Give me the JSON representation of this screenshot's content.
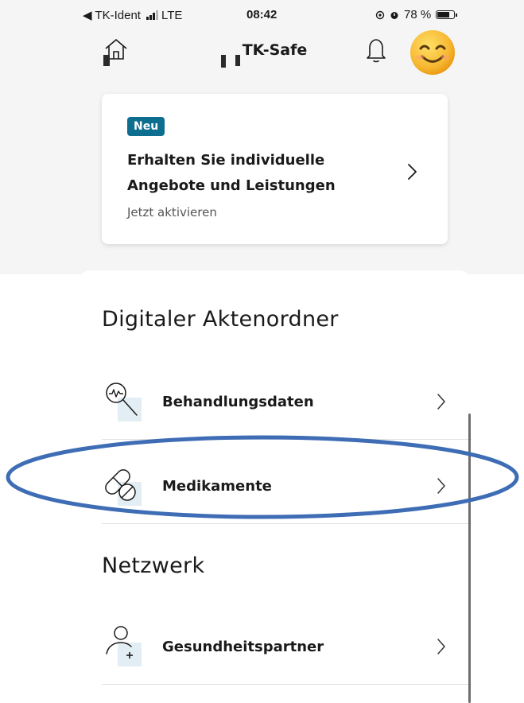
{
  "status_bar": {
    "back_label": "◀ TK-Ident",
    "network": "LTE",
    "time": "08:42",
    "battery_text": "78 %",
    "battery_level": 0.78
  },
  "header": {
    "title": "TK-Safe"
  },
  "colors": {
    "accent": "#0d6e8f",
    "background_top": "#f5f5f6",
    "annotation_circle": "#3f6db5"
  },
  "icons": {
    "home": "home-icon",
    "bell": "bell-icon",
    "avatar": "smiley-avatar-icon",
    "treatment": "magnifier-heartbeat-icon",
    "medication": "pill-icon",
    "partner": "person-plus-icon",
    "chevron": "chevron-right-icon"
  },
  "promo_card": {
    "badge": "Neu",
    "title": "Erhalten Sie individuelle Angebote und Leistungen",
    "subtitle": "Jetzt aktivieren"
  },
  "sections": {
    "digital": {
      "title": "Digitaler Aktenordner",
      "items": [
        {
          "label": "Behandlungsdaten"
        },
        {
          "label": "Medikamente"
        }
      ]
    },
    "network": {
      "title": "Netzwerk",
      "items": [
        {
          "label": "Gesundheitspartner"
        }
      ]
    }
  }
}
